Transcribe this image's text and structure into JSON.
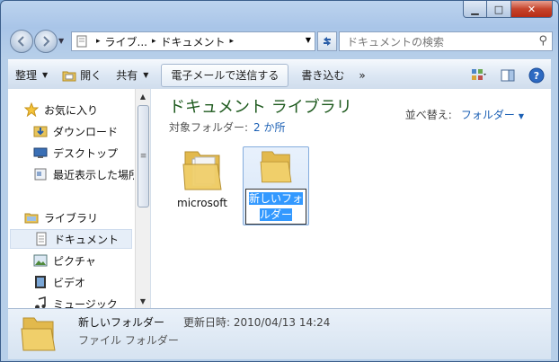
{
  "window": {
    "caption": {
      "minimize": "▁",
      "maximize": "□",
      "close": "✕"
    }
  },
  "address": {
    "crumbs": [
      "ライブ...",
      "ドキュメント"
    ],
    "refresh_icon": "refresh-icon"
  },
  "search": {
    "placeholder": "ドキュメントの検索"
  },
  "toolbar": {
    "organize": "整理",
    "open": "開く",
    "share": "共有",
    "email": "電子メールで送信する",
    "burn": "書き込む",
    "more": "»"
  },
  "nav": {
    "favorites": "お気に入り",
    "downloads": "ダウンロード",
    "desktop": "デスクトップ",
    "recent": "最近表示した場所",
    "libraries": "ライブラリ",
    "documents": "ドキュメント",
    "pictures": "ピクチャ",
    "videos": "ビデオ",
    "music": "ミュージック"
  },
  "content": {
    "title": "ドキュメント ライブラリ",
    "sub_label": "対象フォルダー:",
    "sub_link": "2 か所",
    "arrange_label": "並べ替え:",
    "arrange_value": "フォルダー"
  },
  "files": [
    {
      "name": "microsoft",
      "selected": false
    },
    {
      "name": "新しいフォルダー",
      "selected": true,
      "rename_line1": "新しいフォ",
      "rename_line2": "ルダー"
    }
  ],
  "details": {
    "name": "新しいフォルダー",
    "modified": "更新日時: 2010/04/13 14:24",
    "type": "ファイル フォルダー"
  },
  "colors": {
    "title_green": "#1e5a1e",
    "link_blue": "#1a5fb4",
    "selection": "#3399ff"
  }
}
